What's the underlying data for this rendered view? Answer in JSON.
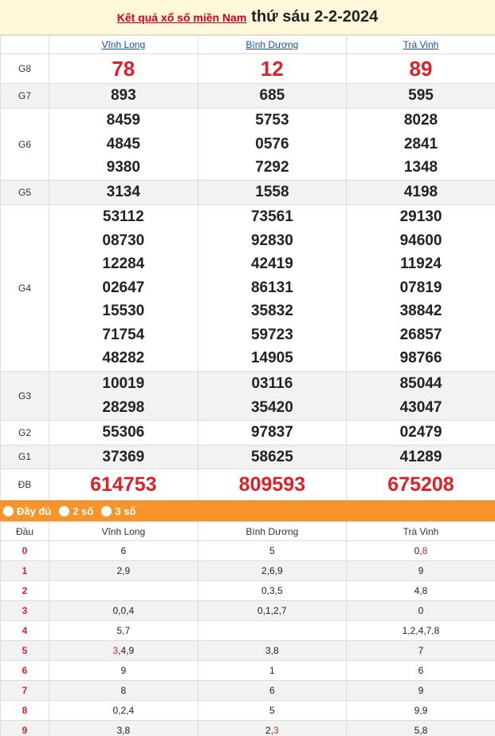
{
  "header": {
    "link": "Kết quả xổ số miền Nam",
    "date": "thứ sáu 2-2-2024"
  },
  "provinces": [
    "Vĩnh Long",
    "Bình Dương",
    "Trà Vinh"
  ],
  "prizes": {
    "g8": {
      "label": "G8",
      "values": [
        "78",
        "12",
        "89"
      ]
    },
    "g7": {
      "label": "G7",
      "values": [
        "893",
        "685",
        "595"
      ]
    },
    "g6": {
      "label": "G6",
      "values": [
        [
          "8459",
          "4845",
          "9380"
        ],
        [
          "5753",
          "0576",
          "7292"
        ],
        [
          "8028",
          "2841",
          "1348"
        ]
      ]
    },
    "g5": {
      "label": "G5",
      "values": [
        "3134",
        "1558",
        "4198"
      ]
    },
    "g4": {
      "label": "G4",
      "values": [
        [
          "53112",
          "08730",
          "12284",
          "02647",
          "15530",
          "71754",
          "48282"
        ],
        [
          "73561",
          "92830",
          "42419",
          "86131",
          "35832",
          "59723",
          "14905"
        ],
        [
          "29130",
          "94600",
          "11924",
          "07819",
          "38842",
          "26857",
          "98766"
        ]
      ]
    },
    "g3": {
      "label": "G3",
      "values": [
        [
          "10019",
          "28298"
        ],
        [
          "03116",
          "35420"
        ],
        [
          "85044",
          "43047"
        ]
      ]
    },
    "g2": {
      "label": "G2",
      "values": [
        "55306",
        "97837",
        "02479"
      ]
    },
    "g1": {
      "label": "G1",
      "values": [
        "37369",
        "58625",
        "41289"
      ]
    },
    "db": {
      "label": "ĐB",
      "values": [
        "614753",
        "809593",
        "675208"
      ]
    }
  },
  "options": [
    "Đầy đủ",
    "2 số",
    "3 số"
  ],
  "loto": {
    "head": "Đầu",
    "rows": [
      {
        "dau": "0",
        "cells": [
          "6",
          "5",
          [
            "0,",
            "8"
          ]
        ]
      },
      {
        "dau": "1",
        "cells": [
          "2,9",
          "2,6,9",
          "9"
        ]
      },
      {
        "dau": "2",
        "cells": [
          "",
          "0,3,5",
          "4,8"
        ]
      },
      {
        "dau": "3",
        "cells": [
          "0,0,4",
          "0,1,2,7",
          "0"
        ]
      },
      {
        "dau": "4",
        "cells": [
          "5,7",
          "",
          "1,2,4,7,8"
        ]
      },
      {
        "dau": "5",
        "cells": [
          [
            "3",
            ",4,9"
          ],
          "3,8",
          "7"
        ]
      },
      {
        "dau": "6",
        "cells": [
          "9",
          "1",
          "6"
        ]
      },
      {
        "dau": "7",
        "cells": [
          "8",
          "6",
          "9"
        ]
      },
      {
        "dau": "8",
        "cells": [
          "0,2,4",
          "5",
          "9,9"
        ]
      },
      {
        "dau": "9",
        "cells": [
          "3,8",
          [
            "2,",
            "3"
          ],
          "5,8"
        ]
      }
    ]
  }
}
